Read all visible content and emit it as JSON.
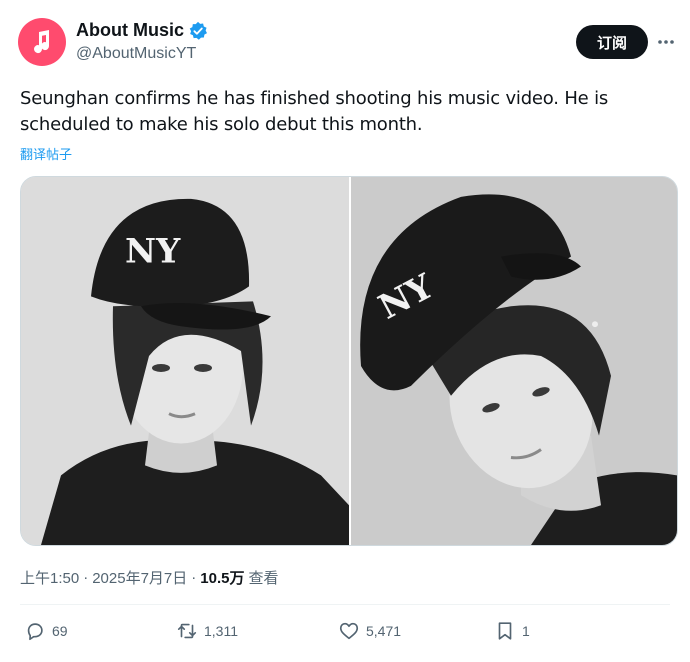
{
  "author": {
    "name": "About Music",
    "handle": "@AboutMusicYT",
    "verified": true,
    "avatar_icon": "music-note-icon",
    "avatar_color": "#ff4b6e"
  },
  "subscribe_label": "订阅",
  "more_icon": "more-icon",
  "tweet": {
    "line1": "Seunghan confirms he has finished shooting his music video. He is",
    "line2": "scheduled to make his solo debut this month.",
    "translate_label": "翻译帖子"
  },
  "media": [
    {
      "alt_icon": "photo-left"
    },
    {
      "alt_icon": "photo-right"
    }
  ],
  "meta": {
    "time": "上午1:50",
    "separator": "·",
    "date": "2025年7月7日",
    "dot": "·",
    "views_count": "10.5万",
    "views_label": "查看"
  },
  "actions": {
    "replies": "69",
    "retweets": "1,311",
    "likes": "5,471",
    "bookmarks": "1"
  },
  "colors": {
    "accent": "#1d9bf0",
    "text": "#0f1419",
    "muted": "#536471"
  }
}
